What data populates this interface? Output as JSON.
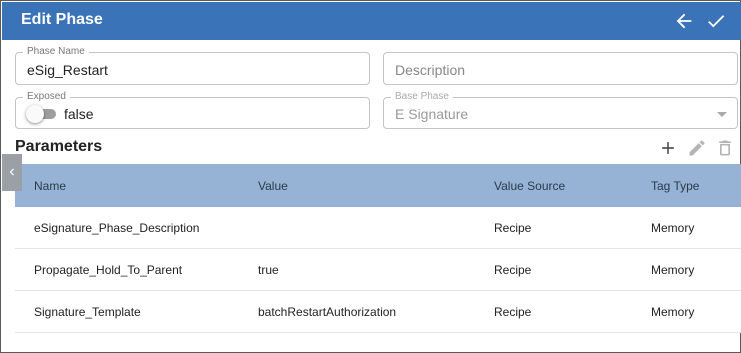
{
  "header": {
    "title": "Edit Phase",
    "back_icon": "arrow-left-icon",
    "save_icon": "check-icon",
    "color": "#3a73b8"
  },
  "form": {
    "phase_name": {
      "label": "Phase Name",
      "value": "eSig_Restart"
    },
    "description": {
      "placeholder": "Description"
    },
    "exposed": {
      "label": "Exposed",
      "value": "false"
    },
    "base_phase": {
      "label": "Base Phase",
      "value": "E Signature"
    }
  },
  "parameters": {
    "title": "Parameters",
    "columns": [
      "Name",
      "Value",
      "Value Source",
      "Tag Type"
    ],
    "rows": [
      {
        "name": "eSignature_Phase_Description",
        "value": "",
        "source": "Recipe",
        "tag_type": "Memory"
      },
      {
        "name": "Propagate_Hold_To_Parent",
        "value": "true",
        "source": "Recipe",
        "tag_type": "Memory"
      },
      {
        "name": "Signature_Template",
        "value": "batchRestartAuthorization",
        "source": "Recipe",
        "tag_type": "Memory"
      }
    ],
    "header_color": "#96b3d6"
  }
}
